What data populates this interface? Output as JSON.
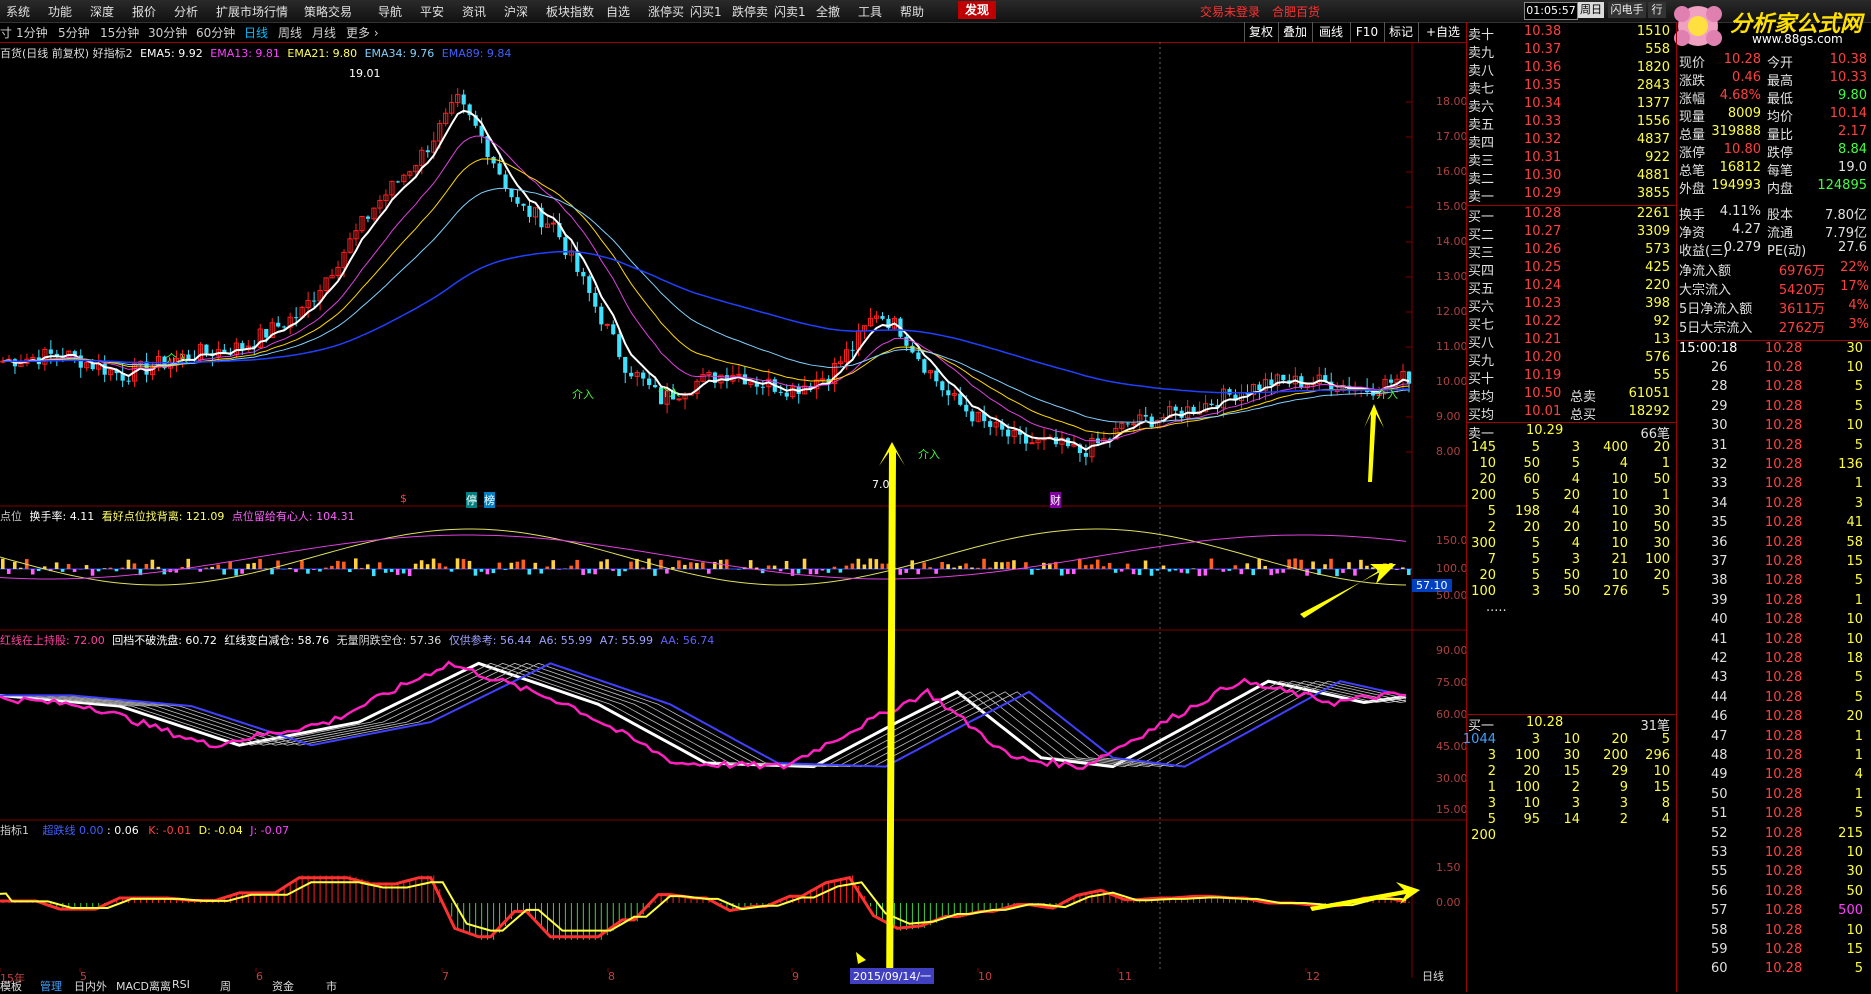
{
  "menu": [
    "系统",
    "功能",
    "深度",
    "报价",
    "分析",
    "扩展市场行情",
    "策略交易",
    "导航",
    "平安",
    "资讯",
    "沪深",
    "板块指数",
    "自选",
    "涨停买",
    "闪买1",
    "跌停卖",
    "闪卖1",
    "全撤",
    "工具",
    "帮助"
  ],
  "menu_highlight": "发现",
  "notices": [
    "交易未登录",
    "合肥百货"
  ],
  "clock": "01:05:57",
  "week_btn": "周日",
  "top_btns": [
    "闪电手",
    "行"
  ],
  "logo": {
    "text": "分析家公式网",
    "url": "www.88gs.com"
  },
  "periods": [
    {
      "label": "寸",
      "on": false
    },
    {
      "label": "1分钟",
      "on": false
    },
    {
      "label": "5分钟",
      "on": false
    },
    {
      "label": "15分钟",
      "on": false
    },
    {
      "label": "30分钟",
      "on": false
    },
    {
      "label": "60分钟",
      "on": false
    },
    {
      "label": "日线",
      "on": true
    },
    {
      "label": "周线",
      "on": false
    },
    {
      "label": "月线",
      "on": false
    },
    {
      "label": "更多 ›",
      "on": false
    }
  ],
  "tools": [
    "复权",
    "叠加",
    "画线",
    "F10",
    "标记",
    "+自选"
  ],
  "main_header": {
    "title": "百货(日线 前复权) 好指标2",
    "ema5": "EMA5: 9.92",
    "ema13": "EMA13: 9.81",
    "ema21": "EMA21: 9.80",
    "ema34": "EMA34: 9.76",
    "ema89": "EMA89: 9.84"
  },
  "annotations": {
    "high": "19.01",
    "low": "7.0",
    "join": "介入",
    "zt": "停",
    "rb": "榜",
    "fin": "财",
    "dollar": "$"
  },
  "colors": {
    "up": "#ff2020",
    "down": "#40e0ff",
    "white": "#ffffff",
    "yellow": "#ffd700",
    "magenta": "#e040e0",
    "blue": "#2040ff",
    "grid": "#800000"
  },
  "ind1": {
    "name": "点位",
    "a": "换手率: 4.11",
    "b": "看好点位找背离: 121.09",
    "c": "点位留给有心人: 104.31",
    "cur": "57.10"
  },
  "ind2": {
    "a": "红线在上持股: 72.00",
    "b": "回档不破洗盘: 60.72",
    "c": "红线变白减仓: 58.76",
    "d": "无量阴跌空仓: 57.36",
    "e": "仅供参考: 56.44",
    "f": "A6: 55.99",
    "g": "A7: 55.99",
    "h": "AA: 56.74"
  },
  "ind3": {
    "name": "指标1",
    "a": "超跌线 0.00",
    "b": ": 0.06",
    "c": "K: -0.01",
    "d": "D: -0.04",
    "e": "J: -0.07"
  },
  "y_main": [
    "18.00",
    "17.00",
    "16.00",
    "15.00",
    "14.00",
    "13.00",
    "12.00",
    "11.00",
    "10.00",
    "9.00",
    "8.00"
  ],
  "y_ind1": [
    "150.0",
    "100.0",
    "50.00"
  ],
  "y_ind2": [
    "90.00",
    "75.00",
    "60.00",
    "45.00",
    "30.00",
    "15.00"
  ],
  "y_ind3": [
    "1.50",
    "0.00"
  ],
  "x_labels": [
    "15年",
    "5",
    "6",
    "7",
    "8",
    "9",
    "10",
    "11",
    "12"
  ],
  "cursor_date": "2015/09/14/一",
  "period_tag": "日线",
  "bottom_tabs": [
    "模板",
    "管理",
    "日内外",
    "MACD离离",
    "RSI",
    "周",
    "资金",
    "市"
  ],
  "sell": [
    {
      "l": "卖十",
      "p": "10.38",
      "v": "1510"
    },
    {
      "l": "卖九",
      "p": "10.37",
      "v": "558"
    },
    {
      "l": "卖八",
      "p": "10.36",
      "v": "1820"
    },
    {
      "l": "卖七",
      "p": "10.35",
      "v": "2843"
    },
    {
      "l": "卖六",
      "p": "10.34",
      "v": "1377"
    },
    {
      "l": "卖五",
      "p": "10.33",
      "v": "1556"
    },
    {
      "l": "卖四",
      "p": "10.32",
      "v": "4837"
    },
    {
      "l": "卖三",
      "p": "10.31",
      "v": "922"
    },
    {
      "l": "卖二",
      "p": "10.30",
      "v": "4881"
    },
    {
      "l": "卖一",
      "p": "10.29",
      "v": "3855"
    }
  ],
  "buy": [
    {
      "l": "买一",
      "p": "10.28",
      "v": "2261"
    },
    {
      "l": "买二",
      "p": "10.27",
      "v": "3309"
    },
    {
      "l": "买三",
      "p": "10.26",
      "v": "573"
    },
    {
      "l": "买四",
      "p": "10.25",
      "v": "425"
    },
    {
      "l": "买五",
      "p": "10.24",
      "v": "220"
    },
    {
      "l": "买六",
      "p": "10.23",
      "v": "398"
    },
    {
      "l": "买七",
      "p": "10.22",
      "v": "92"
    },
    {
      "l": "买八",
      "p": "10.21",
      "v": "13"
    },
    {
      "l": "买九",
      "p": "10.20",
      "v": "576"
    },
    {
      "l": "买十",
      "p": "10.19",
      "v": "55"
    }
  ],
  "avg": [
    {
      "l": "卖均",
      "p": "10.50",
      "k": "总卖",
      "v": "61051"
    },
    {
      "l": "买均",
      "p": "10.01",
      "k": "总买",
      "v": "18292"
    }
  ],
  "queue_sell": {
    "head": "卖一",
    "price": "10.29",
    "count": "66笔",
    "rows": [
      [
        "145",
        "5",
        "3",
        "400",
        "20"
      ],
      [
        "10",
        "50",
        "5",
        "4",
        "1"
      ],
      [
        "20",
        "60",
        "4",
        "10",
        "50"
      ],
      [
        "200",
        "5",
        "20",
        "10",
        "1"
      ],
      [
        "5",
        "198",
        "4",
        "10",
        "30"
      ],
      [
        "2",
        "20",
        "20",
        "10",
        "50"
      ],
      [
        "300",
        "5",
        "4",
        "10",
        "30"
      ],
      [
        "7",
        "5",
        "3",
        "21",
        "100"
      ],
      [
        "20",
        "5",
        "50",
        "10",
        "20"
      ],
      [
        "100",
        "3",
        "50",
        "276",
        "5"
      ]
    ],
    "more": "....."
  },
  "queue_buy": {
    "head": "买一",
    "price": "10.28",
    "count": "31笔",
    "rows": [
      [
        "1044",
        "3",
        "10",
        "20",
        "5"
      ],
      [
        "3",
        "100",
        "30",
        "200",
        "296"
      ],
      [
        "2",
        "20",
        "15",
        "29",
        "10"
      ],
      [
        "1",
        "100",
        "2",
        "9",
        "15"
      ],
      [
        "3",
        "10",
        "3",
        "3",
        "8"
      ],
      [
        "5",
        "95",
        "14",
        "2",
        "4"
      ],
      [
        "200",
        "",
        "",
        "",
        ""
      ]
    ]
  },
  "stats": [
    [
      "现价",
      "10.28",
      "今开",
      "10.38"
    ],
    [
      "涨跌",
      "0.46",
      "最高",
      "10.33"
    ],
    [
      "涨幅",
      "4.68%",
      "最低",
      "9.80"
    ],
    [
      "现量",
      "8009",
      "均价",
      "10.14"
    ],
    [
      "总量",
      "319888",
      "量比",
      "2.17"
    ],
    [
      "涨停",
      "10.80",
      "跌停",
      "8.84"
    ],
    [
      "总笔",
      "16812",
      "每笔",
      "19.0"
    ],
    [
      "外盘",
      "194993",
      "内盘",
      "124895"
    ]
  ],
  "stats2": [
    [
      "换手",
      "4.11%",
      "股本",
      "7.80亿"
    ],
    [
      "净资",
      "4.27",
      "流通",
      "7.79亿"
    ],
    [
      "收益(三)",
      "0.279",
      "PE(动)",
      "27.6"
    ]
  ],
  "flows": [
    [
      "净流入额",
      "6976万",
      "22%"
    ],
    [
      "大宗流入",
      "5420万",
      "17%"
    ],
    [
      "5日净流入额",
      "3611万",
      "4%"
    ],
    [
      "5日大宗流入",
      "2762万",
      "3%"
    ]
  ],
  "ticks_head": {
    "time": "15:00:18",
    "price": "10.28",
    "vol": "30"
  },
  "ticks": [
    [
      "26",
      "10.28",
      "10"
    ],
    [
      "28",
      "10.28",
      "5"
    ],
    [
      "29",
      "10.28",
      "5"
    ],
    [
      "30",
      "10.28",
      "10"
    ],
    [
      "31",
      "10.28",
      "5"
    ],
    [
      "32",
      "10.28",
      "136"
    ],
    [
      "33",
      "10.28",
      "1"
    ],
    [
      "34",
      "10.28",
      "3"
    ],
    [
      "35",
      "10.28",
      "41"
    ],
    [
      "36",
      "10.28",
      "58"
    ],
    [
      "37",
      "10.28",
      "15"
    ],
    [
      "38",
      "10.28",
      "5"
    ],
    [
      "39",
      "10.28",
      "1"
    ],
    [
      "40",
      "10.28",
      "10"
    ],
    [
      "41",
      "10.28",
      "10"
    ],
    [
      "42",
      "10.28",
      "18"
    ],
    [
      "43",
      "10.28",
      "5"
    ],
    [
      "44",
      "10.28",
      "5"
    ],
    [
      "46",
      "10.28",
      "20"
    ],
    [
      "47",
      "10.28",
      "1"
    ],
    [
      "48",
      "10.28",
      "1"
    ],
    [
      "49",
      "10.28",
      "4"
    ],
    [
      "50",
      "10.28",
      "1"
    ],
    [
      "51",
      "10.28",
      "5"
    ],
    [
      "52",
      "10.28",
      "215"
    ],
    [
      "53",
      "10.28",
      "10"
    ],
    [
      "55",
      "10.28",
      "30"
    ],
    [
      "56",
      "10.28",
      "50"
    ],
    [
      "57",
      "10.28",
      "500"
    ],
    [
      "58",
      "10.28",
      "10"
    ],
    [
      "59",
      "10.28",
      "15"
    ],
    [
      "60",
      "10.28",
      "5"
    ]
  ]
}
